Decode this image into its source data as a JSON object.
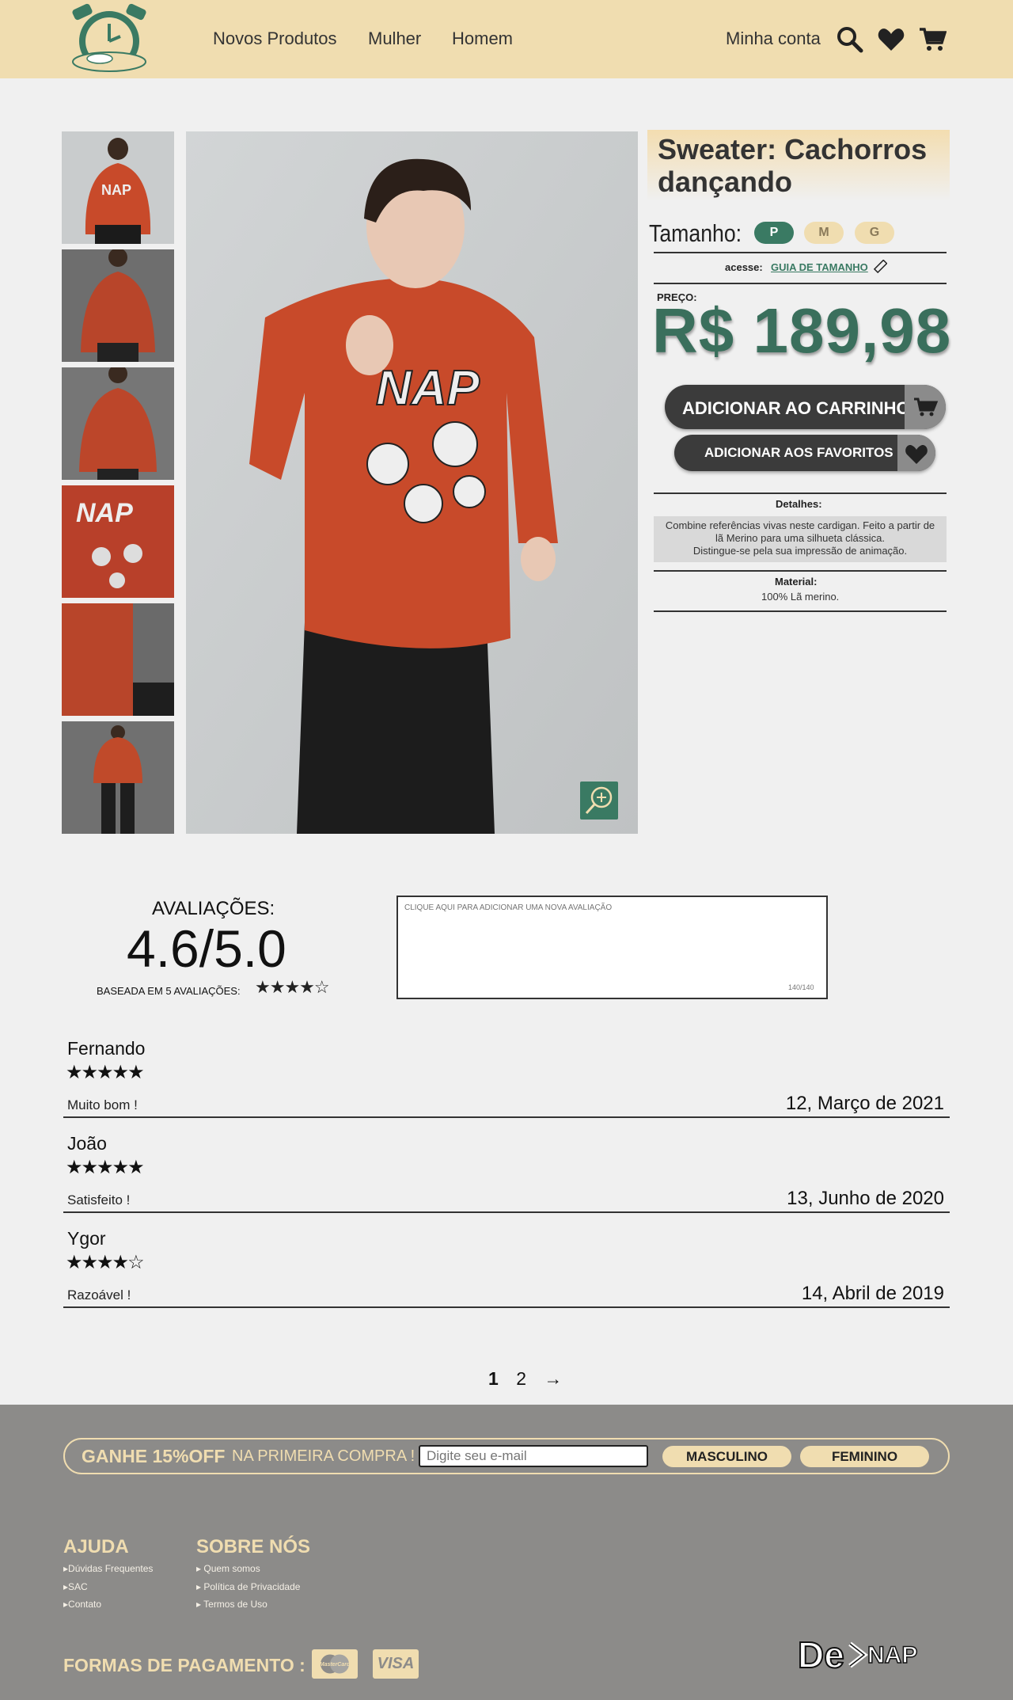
{
  "header": {
    "nav": [
      "Novos Produtos",
      "Mulher",
      "Homem"
    ],
    "account": "Minha conta",
    "icons": [
      "search-icon",
      "heart-icon",
      "cart-icon"
    ]
  },
  "product": {
    "title": "Sweater: Cachorros dançando",
    "size_label": "Tamanho:",
    "sizes": [
      "P",
      "M",
      "G"
    ],
    "selected_size": "P",
    "guide_prefix": "acesse:",
    "guide_link": "GUIA DE TAMANHO",
    "price_label": "PREÇO:",
    "price": "R$ 189,98",
    "add_to_cart": "ADICIONAR AO CARRINHO",
    "add_to_favorites": "ADICIONAR AOS FAVORITOS",
    "details_label": "Detalhes:",
    "details": [
      "Combine referências vivas neste cardigan. Feito a partir de",
      "lã Merino para uma silhueta clássica.",
      "Distingue-se pela sua impressão de animação."
    ],
    "material_label": "Material:",
    "material": "100% Lã merino."
  },
  "reviews_summary": {
    "title": "AVALIAÇÕES:",
    "score": "4.6/5.0",
    "based_on": "BASEADA EM 5 AVALIAÇÕES:",
    "rating": 4.6,
    "input_placeholder": "CLIQUE AQUI PARA ADICIONAR UMA NOVA AVALIAÇÃO",
    "char_count": "140/140"
  },
  "reviews": [
    {
      "name": "Fernando",
      "stars": 5,
      "text": "Muito bom !",
      "date": "12, Março de 2021"
    },
    {
      "name": "João",
      "stars": 5,
      "text": "Satisfeito !",
      "date": "13, Junho de 2020"
    },
    {
      "name": "Ygor",
      "stars": 4,
      "text": "Razoável !",
      "date": "14, Abril de 2019"
    }
  ],
  "pagination": {
    "pages": [
      "1",
      "2"
    ],
    "current": "1",
    "next": "→"
  },
  "footer": {
    "promo_bold": "GANHE 15%OFF",
    "promo_text": "NA PRIMEIRA COMPRA !",
    "email_placeholder": "Digite seu e-mail",
    "btn_male": "MASCULINO",
    "btn_female": "FEMININO",
    "help_title": "AJUDA",
    "help_links": [
      "Dúvidas Frequentes",
      "SAC",
      "Contato"
    ],
    "about_title": "SOBRE NÓS",
    "about_links": [
      "Quem somos",
      "Política de Privacidade",
      "Termos de Uso"
    ],
    "payment_label": "FORMAS DE PAGAMENTO :",
    "cards": [
      "MasterCard",
      "VISA"
    ],
    "brand_logo": "DeNAP"
  },
  "colors": {
    "cream": "#f0ddb0",
    "green": "#3a7a63",
    "dark": "#3b3b3b",
    "footer": "#8c8b89",
    "sweater": "#c84a2a"
  }
}
